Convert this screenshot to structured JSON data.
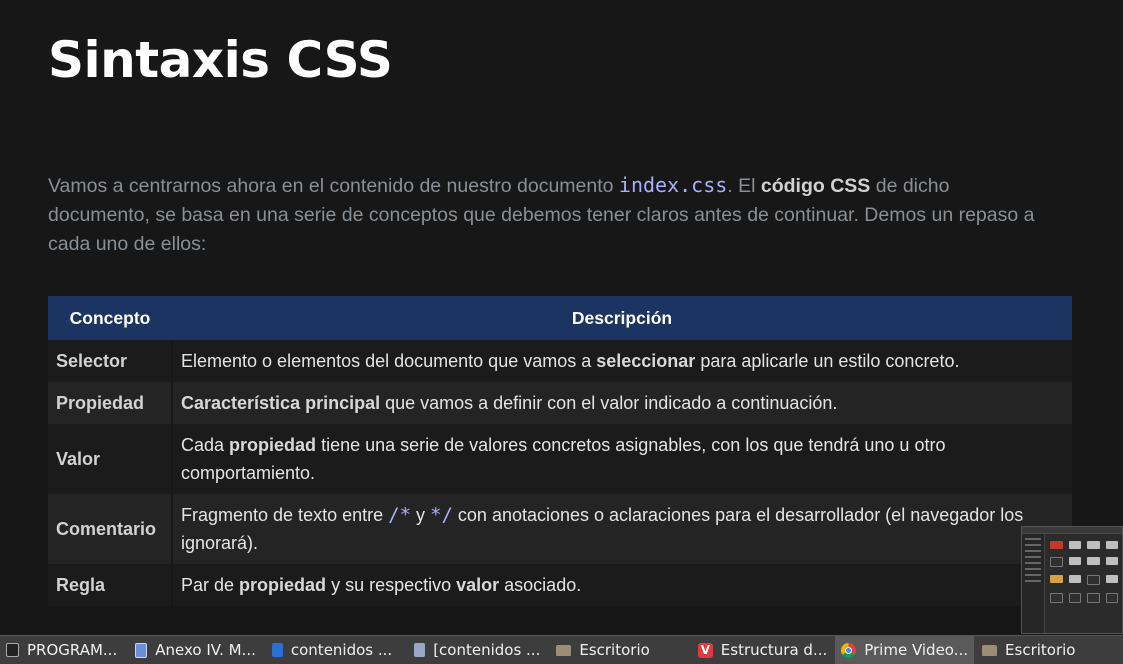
{
  "page": {
    "title": "Sintaxis CSS",
    "intro": {
      "p1": "Vamos a centrarnos ahora en el contenido de nuestro documento ",
      "code": "index.css",
      "p2": ". El ",
      "bold": "código CSS",
      "p3": " de dicho documento, se basa en una serie de conceptos que debemos tener claros antes de continuar. Demos un repaso a cada uno de ellos:"
    }
  },
  "table": {
    "headers": [
      "Concepto",
      "Descripción"
    ],
    "rows": [
      {
        "term": "Selector",
        "t1": "Elemento o elementos del documento que vamos a ",
        "b1": "seleccionar",
        "t2": " para aplicarle un estilo concreto."
      },
      {
        "term": "Propiedad",
        "b1": "Característica principal",
        "t1": " que vamos a definir con el valor indicado a continuación."
      },
      {
        "term": "Valor",
        "t1": "Cada ",
        "b1": "propiedad",
        "t2": " tiene una serie de valores concretos asignables, con los que tendrá uno u otro comportamiento."
      },
      {
        "term": "Comentario",
        "t1": "Fragmento de texto entre ",
        "s1": "/*",
        "t2": " y ",
        "s2": "*/",
        "t3": " con anotaciones o aclaraciones para el desarrollador (el navegador los ignorará)."
      },
      {
        "term": "Regla",
        "t1": "Par de ",
        "b1": "propiedad",
        "t2": " y su respectivo ",
        "b2": "valor",
        "t3": " asociado."
      }
    ]
  },
  "taskbar": {
    "items": [
      {
        "label": "PROGRAM...",
        "icon": "terminal-icon"
      },
      {
        "label": "Anexo IV. M...",
        "icon": "document-icon"
      },
      {
        "label": "contenidos ...",
        "icon": "writer-icon"
      },
      {
        "label": "[contenidos ...",
        "icon": "document-icon"
      },
      {
        "label": "Escritorio",
        "icon": "folder-icon"
      },
      {
        "label": "Estructura d...",
        "icon": "vivaldi-icon"
      },
      {
        "label": "Prime Video...",
        "icon": "chrome-icon",
        "active": true
      },
      {
        "label": "Escritorio",
        "icon": "folder-icon"
      }
    ]
  },
  "colors": {
    "background": "#171717",
    "header_bg": "#1c3461",
    "code_accent": "#a8b0ff",
    "taskbar_bg": "#3d3d3d"
  }
}
